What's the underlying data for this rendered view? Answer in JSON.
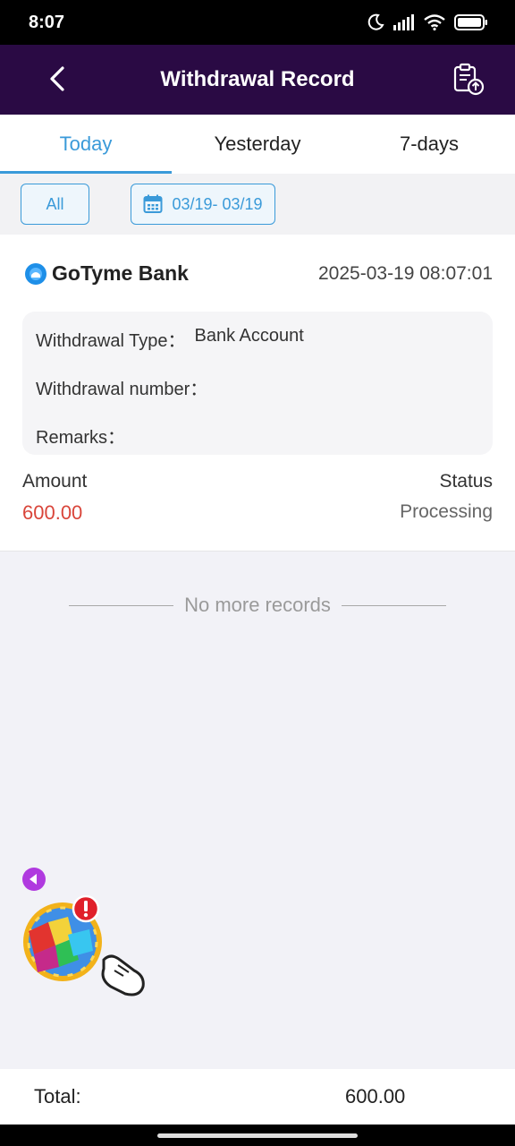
{
  "status_bar": {
    "time": "8:07"
  },
  "header": {
    "title": "Withdrawal Record",
    "back_icon": "chevron-left-icon",
    "record_icon": "clipboard-upload-icon"
  },
  "tabs": [
    {
      "label": "Today",
      "active": true
    },
    {
      "label": "Yesterday",
      "active": false
    },
    {
      "label": "7-days",
      "active": false
    }
  ],
  "filters": {
    "all_label": "All",
    "date_range": "03/19- 03/19"
  },
  "record": {
    "bank_name": "GoTyme Bank",
    "datetime": "2025-03-19 08:07:01",
    "withdrawal_type_label": "Withdrawal Type：",
    "withdrawal_type_value": "Bank Account",
    "withdrawal_number_label": "Withdrawal number：",
    "remarks_label": "Remarks：",
    "amount_label": "Amount",
    "amount_value": "600.00",
    "status_label": "Status",
    "status_value": "Processing"
  },
  "list_end": {
    "text": "No more records"
  },
  "footer": {
    "total_label": "Total:",
    "total_value": "600.00"
  },
  "colors": {
    "header_bg": "#2a0a44",
    "accent": "#3a9ad9",
    "amount": "#d9453a"
  }
}
